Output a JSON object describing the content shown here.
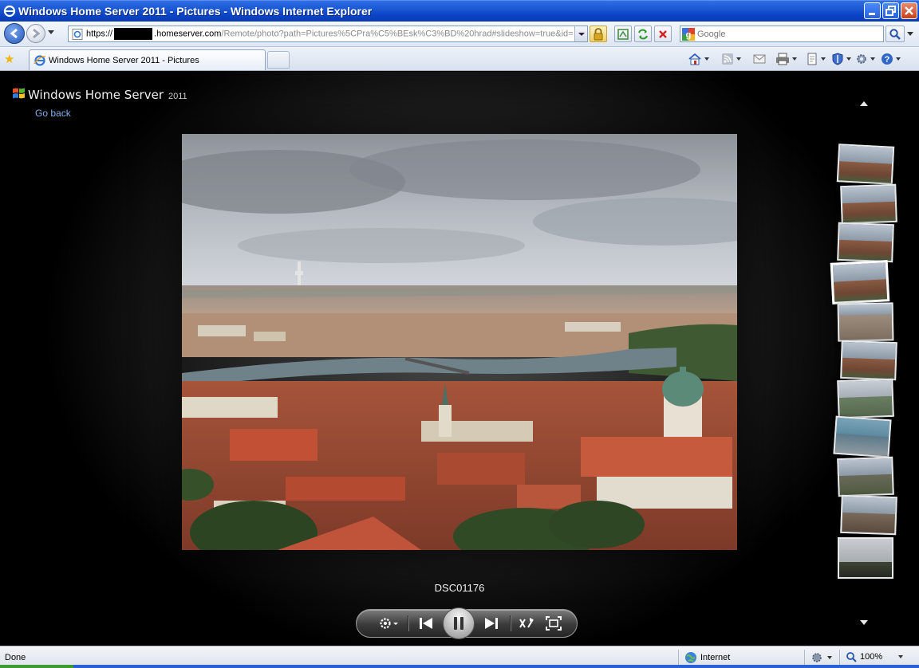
{
  "window": {
    "title": "Windows Home Server 2011 - Pictures - Windows Internet Explorer"
  },
  "address_bar": {
    "scheme": "https://",
    "host": ".homeserver.com",
    "path": "/Remote/photo?path=Pictures%5CPra%C5%BEsk%C3%BD%20hrad#slideshow=true&id=",
    "search_placeholder": "Google"
  },
  "tab": {
    "label": "Windows Home Server 2011 - Pictures"
  },
  "viewer": {
    "brand_name": "Windows Home Server",
    "brand_year": "2011",
    "go_back": "Go back",
    "photo_caption": "DSC01176",
    "thumbnail_count": 11,
    "selected_thumbnail_index": 3
  },
  "status_bar": {
    "status": "Done",
    "zone": "Internet",
    "zoom": "100%"
  },
  "colors": {
    "titlebar_blue": "#0a44c6",
    "link_blue": "#7fb3ec",
    "viewer_background": "#000000"
  }
}
